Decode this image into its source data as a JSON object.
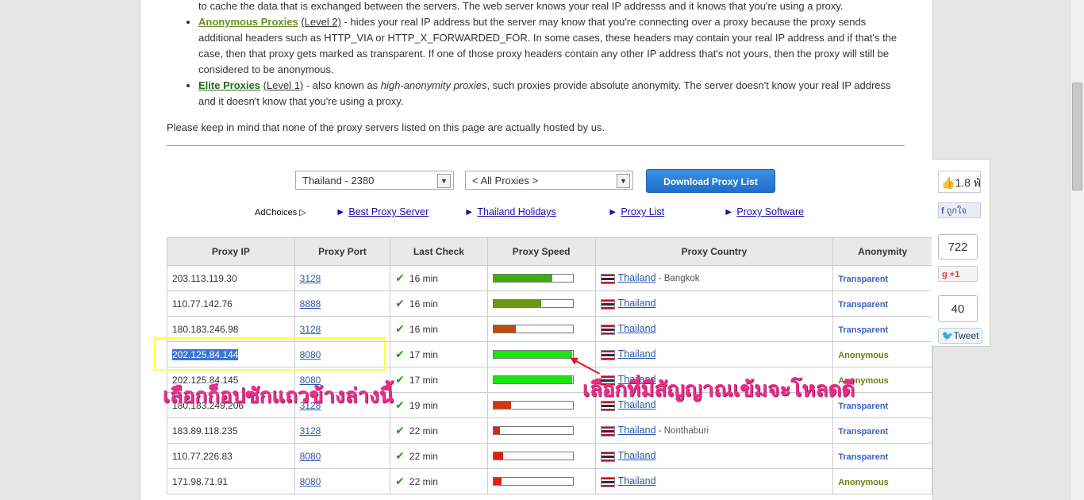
{
  "intro": {
    "line0": "to cache the data that is exchanged between the servers. The web server knows your real IP addresss and it knows that you're using a proxy.",
    "anon_title": "Anonymous Proxies",
    "anon_level": "(Level 2)",
    "anon_text": " - hides your real IP address but the server may know that you're connecting over a proxy because the proxy sends additional headers such as HTTP_VIA or HTTP_X_FORWARDED_FOR. In some cases, these headers may contain your real IP address and if that's the case, then that proxy gets marked as transparent. If one of those proxy headers contain any other IP address that's not yours, then the proxy will still be considered to be anonymous.",
    "elite_title": "Elite Proxies",
    "elite_level": "(Level 1)",
    "elite_text_a": " - also known as ",
    "elite_text_em": "high-anonymity proxies",
    "elite_text_b": ", such proxies provide absolute anonymity. The server doesn't know your real IP address and it doesn't know that you're using a proxy.",
    "keep": "Please keep in mind that none of the proxy servers listed on this page are actually hosted by us."
  },
  "filters": {
    "country": "Thailand - 2380",
    "type": "< All Proxies >",
    "download": "Download Proxy List"
  },
  "ads": {
    "adchoices": "AdChoices",
    "links": [
      "Best Proxy Server",
      "Thailand Holidays",
      "Proxy List",
      "Proxy Software"
    ]
  },
  "table": {
    "headers": [
      "Proxy IP",
      "Proxy Port",
      "Last Check",
      "Proxy Speed",
      "Proxy Country",
      "Anonymity"
    ],
    "rows": [
      {
        "ip": "203.113.119.30",
        "port": "3128",
        "check": "16 min",
        "speed": 0.74,
        "color": "#3fae0c",
        "country": "Thailand",
        "city": " - Bangkok",
        "anon": "Transparent"
      },
      {
        "ip": "110.77.142.76",
        "port": "8888",
        "check": "16 min",
        "speed": 0.6,
        "color": "#6a9a12",
        "country": "Thailand",
        "city": "",
        "anon": "Transparent"
      },
      {
        "ip": "180.183.246.98",
        "port": "3128",
        "check": "16 min",
        "speed": 0.28,
        "color": "#c04a0c",
        "country": "Thailand",
        "city": "",
        "anon": "Transparent"
      },
      {
        "ip": "202.125.84.144",
        "port": "8080",
        "check": "17 min",
        "speed": 0.99,
        "color": "#19e80f",
        "country": "Thailand",
        "city": "",
        "anon": "Anonymous"
      },
      {
        "ip": "202.125.84.145",
        "port": "8080",
        "check": "17 min",
        "speed": 0.99,
        "color": "#19e80f",
        "country": "Thailand",
        "city": "",
        "anon": "Anonymous"
      },
      {
        "ip": "180.183.249.206",
        "port": "3128",
        "check": "19 min",
        "speed": 0.22,
        "color": "#cc3a0c",
        "country": "Thailand",
        "city": "",
        "anon": "Transparent"
      },
      {
        "ip": "183.89.118.235",
        "port": "3128",
        "check": "22 min",
        "speed": 0.08,
        "color": "#e0220c",
        "country": "Thailand",
        "city": " - Nonthaburi",
        "anon": "Transparent"
      },
      {
        "ip": "110.77.226.83",
        "port": "8080",
        "check": "22 min",
        "speed": 0.12,
        "color": "#e0220c",
        "country": "Thailand",
        "city": "",
        "anon": "Transparent"
      },
      {
        "ip": "171.98.71.91",
        "port": "8080",
        "check": "22 min",
        "speed": 0.1,
        "color": "#e0220c",
        "country": "Thailand",
        "city": "",
        "anon": "Anonymous"
      }
    ]
  },
  "annotations": {
    "left_note": "เลือกก็อปซักแถวข้างล่างนี้",
    "right_note": "เลือกที่มีสัญญาณเข้มจะโหลดดี"
  },
  "share": {
    "like_count": "1.8 พั",
    "fb_label": "ถูกใจ",
    "gplus_count": "722",
    "gplus_label": "+1",
    "tweet_count": "40",
    "tweet_label": "Tweet"
  }
}
